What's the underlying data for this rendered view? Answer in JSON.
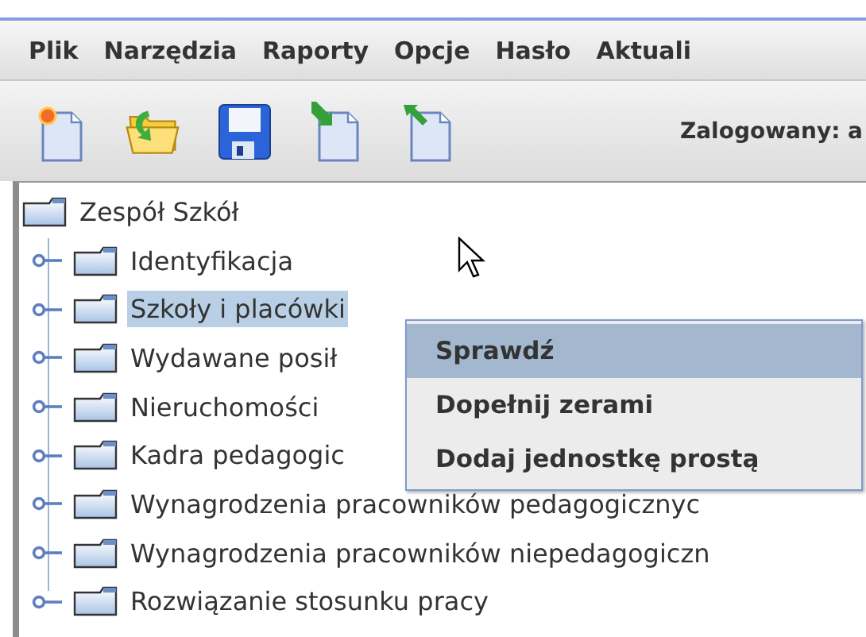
{
  "menu_bar": {
    "items": [
      {
        "label": "Plik"
      },
      {
        "label": "Narzędzia"
      },
      {
        "label": "Raporty"
      },
      {
        "label": "Opcje"
      },
      {
        "label": "Hasło"
      },
      {
        "label": "Aktuali"
      }
    ]
  },
  "toolbar": {
    "buttons": [
      {
        "kind": "new"
      },
      {
        "kind": "open"
      },
      {
        "kind": "save"
      },
      {
        "kind": "import"
      },
      {
        "kind": "export"
      }
    ],
    "status": "Zalogowany: a"
  },
  "tree": {
    "root": {
      "label": "Zespół Szkół",
      "children": [
        {
          "label": "Identyfikacja",
          "selected": false
        },
        {
          "label": "Szkoły i placówki",
          "selected": true
        },
        {
          "label": "Wydawane posił",
          "selected": false
        },
        {
          "label": "Nieruchomości",
          "selected": false
        },
        {
          "label": "Kadra pedagogic",
          "selected": false
        },
        {
          "label": "Wynagrodzenia pracowników pedagogicznyc",
          "selected": false
        },
        {
          "label": "Wynagrodzenia pracowników niepedagogiczn",
          "selected": false
        },
        {
          "label": "Rozwiązanie stosunku pracy",
          "selected": false
        }
      ]
    }
  },
  "context_menu": {
    "items": [
      {
        "label": "Sprawdź",
        "selected": true
      },
      {
        "label": "Dopełnij zerami",
        "selected": false
      },
      {
        "label": "Dodaj jednostkę prostą",
        "selected": false
      }
    ]
  }
}
